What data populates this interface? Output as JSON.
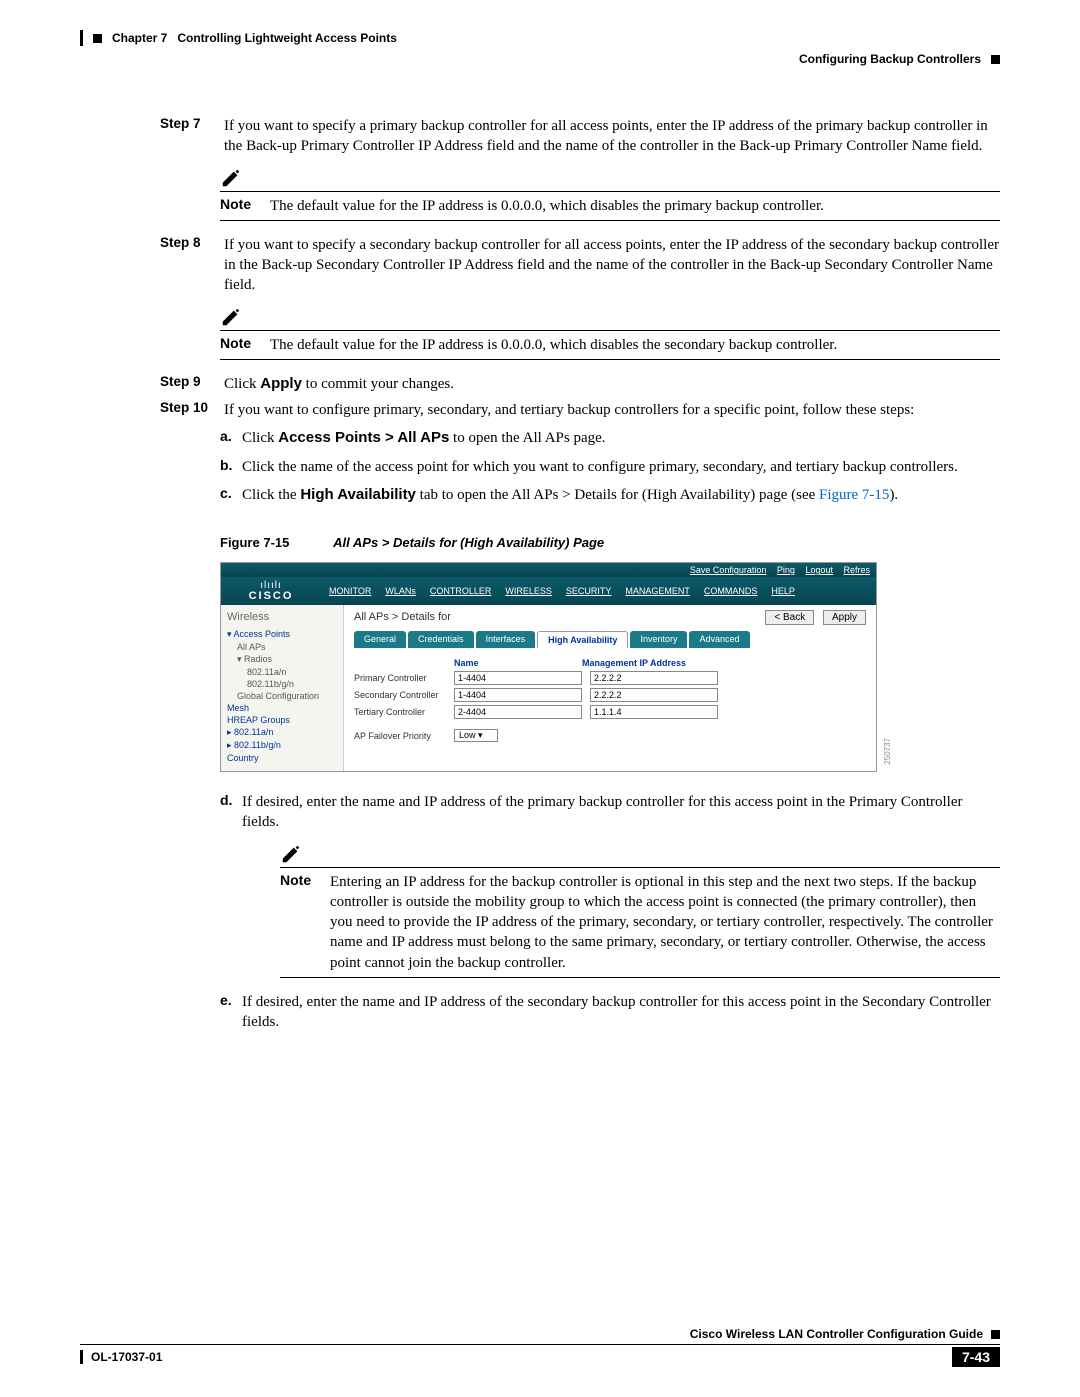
{
  "header": {
    "chapter": "Chapter 7",
    "title": "Controlling Lightweight Access Points",
    "section": "Configuring Backup Controllers"
  },
  "steps": {
    "s7": {
      "label": "Step 7",
      "text": "If you want to specify a primary backup controller for all access points, enter the IP address of the primary backup controller in the Back-up Primary Controller IP Address field and the name of the controller in the Back-up Primary Controller Name field."
    },
    "s7note": {
      "label": "Note",
      "text": "The default value for the IP address is 0.0.0.0, which disables the primary backup controller."
    },
    "s8": {
      "label": "Step 8",
      "text": "If you want to specify a secondary backup controller for all access points, enter the IP address of the secondary backup controller in the Back-up Secondary Controller IP Address field and the name of the controller in the Back-up Secondary Controller Name field."
    },
    "s8note": {
      "label": "Note",
      "text": "The default value for the IP address is 0.0.0.0, which disables the secondary backup controller."
    },
    "s9": {
      "label": "Step 9",
      "pre": "Click ",
      "bold": "Apply",
      "post": " to commit your changes."
    },
    "s10": {
      "label": "Step 10",
      "text": "If you want to configure primary, secondary, and tertiary backup controllers for a specific point, follow these steps:",
      "a": {
        "letter": "a.",
        "pre": "Click ",
        "bold": "Access Points > All APs",
        "post": " to open the All APs page."
      },
      "b": {
        "letter": "b.",
        "text": "Click the name of the access point for which you want to configure primary, secondary, and tertiary backup controllers."
      },
      "c": {
        "letter": "c.",
        "pre": "Click the ",
        "bold": "High Availability",
        "mid": " tab to open the All APs > Details for (High Availability) page (see ",
        "link": "Figure 7-15",
        "post": ")."
      },
      "d": {
        "letter": "d.",
        "text": "If desired, enter the name and IP address of the primary backup controller for this access point in the Primary Controller fields."
      },
      "dnote": {
        "label": "Note",
        "text": "Entering an IP address for the backup controller is optional in this step and the next two steps. If the backup controller is outside the mobility group to which the access point is connected (the primary controller), then you need to provide the IP address of the primary, secondary, or tertiary controller, respectively. The controller name and IP address must belong to the same primary, secondary, or tertiary controller. Otherwise, the access point cannot join the backup controller."
      },
      "e": {
        "letter": "e.",
        "text": "If desired, enter the name and IP address of the secondary backup controller for this access point in the Secondary Controller fields."
      }
    }
  },
  "figure": {
    "label": "Figure 7-15",
    "caption": "All APs > Details for (High Availability) Page"
  },
  "screenshot": {
    "toplinks": {
      "save": "Save Configuration",
      "ping": "Ping",
      "logout": "Logout",
      "refresh": "Refres"
    },
    "logo": {
      "bars": "ılıılı",
      "name": "CISCO"
    },
    "menu": [
      "MONITOR",
      "WLANs",
      "CONTROLLER",
      "WIRELESS",
      "SECURITY",
      "MANAGEMENT",
      "COMMANDS",
      "HELP"
    ],
    "sidebar": {
      "title": "Wireless",
      "items": [
        "Access Points",
        "All APs",
        "Radios",
        "802.11a/n",
        "802.11b/g/n",
        "Global Configuration",
        "Mesh",
        "HREAP Groups",
        "802.11a/n",
        "802.11b/g/n",
        "Country"
      ]
    },
    "main": {
      "title": "All APs > Details for",
      "back": "< Back",
      "apply": "Apply",
      "tabs": [
        "General",
        "Credentials",
        "Interfaces",
        "High Availability",
        "Inventory",
        "Advanced"
      ],
      "form": {
        "h_name": "Name",
        "h_ip": "Management IP Address",
        "primary": {
          "label": "Primary Controller",
          "name": "1-4404",
          "ip": "2.2.2.2"
        },
        "secondary": {
          "label": "Secondary Controller",
          "name": "1-4404",
          "ip": "2.2.2.2"
        },
        "tertiary": {
          "label": "Tertiary Controller",
          "name": "2-4404",
          "ip": "1.1.1.4"
        },
        "failover": {
          "label": "AP Failover Priority",
          "value": "Low"
        }
      }
    },
    "watermark": "250737"
  },
  "footer": {
    "guide": "Cisco Wireless LAN Controller Configuration Guide",
    "docnum": "OL-17037-01",
    "pagenum": "7-43"
  }
}
